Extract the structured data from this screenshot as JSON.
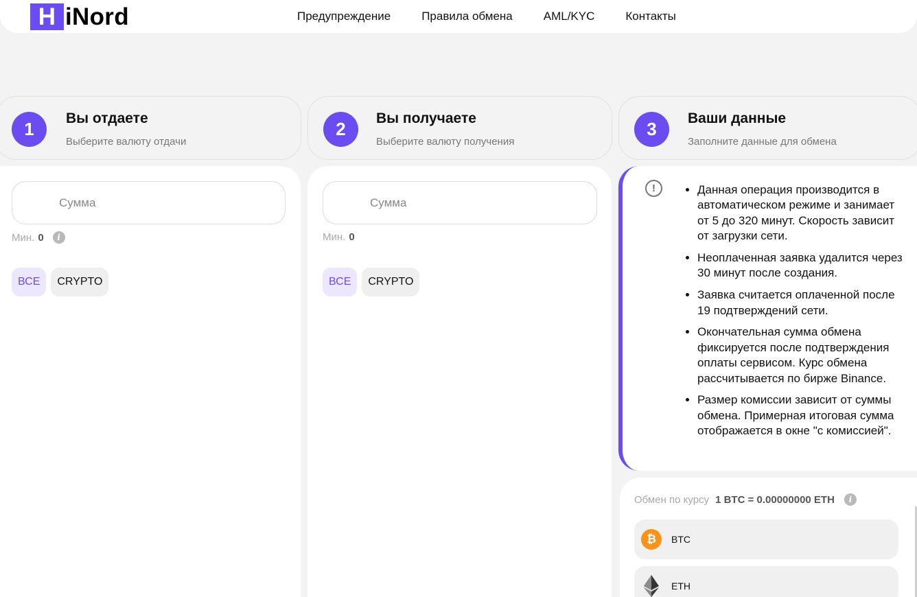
{
  "header": {
    "logo_first": "H",
    "logo_rest": "iNord",
    "nav": [
      "Предупреждение",
      "Правила обмена",
      "AML/KYC",
      "Контакты"
    ]
  },
  "steps": [
    {
      "number": "1",
      "title": "Вы отдаете",
      "subtitle": "Выберите валюту отдачи"
    },
    {
      "number": "2",
      "title": "Вы получаете",
      "subtitle": "Выберите валюту получения"
    },
    {
      "number": "3",
      "title": "Ваши данные",
      "subtitle": "Заполните данные для обмена"
    }
  ],
  "give": {
    "amount_placeholder": "Сумма",
    "min_label": "Мин.",
    "min_value": "0",
    "filters": [
      "ВСЕ",
      "CRYPTO"
    ]
  },
  "receive": {
    "amount_placeholder": "Сумма",
    "min_label": "Мин.",
    "min_value": "0",
    "filters": [
      "ВСЕ",
      "CRYPTO"
    ]
  },
  "notice": {
    "icon": "!",
    "items": [
      "Данная операция производится в автоматическом режиме и занимает от 5 до 320 минут. Скорость зависит от загрузки сети.",
      "Неоплаченная заявка удалится через 30 минут после создания.",
      "Заявка считается оплаченной после 19 подтверждений сети.",
      "Окончательная сумма обмена фиксируется после подтверждения оплаты сервисом. Курс обмена рассчитывается по бирже Binance.",
      "Размер комиссии зависит от суммы обмена. Примерная итоговая сумма отображается в окне \"с комиссией\"."
    ]
  },
  "rate": {
    "label": "Обмен по курсу",
    "value": "1 BTC = 0.00000000 ETH"
  },
  "coins": [
    {
      "name": "BTC",
      "icon": "bitcoin-icon",
      "symbol": "₿"
    },
    {
      "name": "ETH",
      "icon": "ethereum-icon"
    }
  ],
  "colors": {
    "accent": "#6a4cf0",
    "background": "#f3f3f3",
    "bitcoin": "#f7931a"
  }
}
